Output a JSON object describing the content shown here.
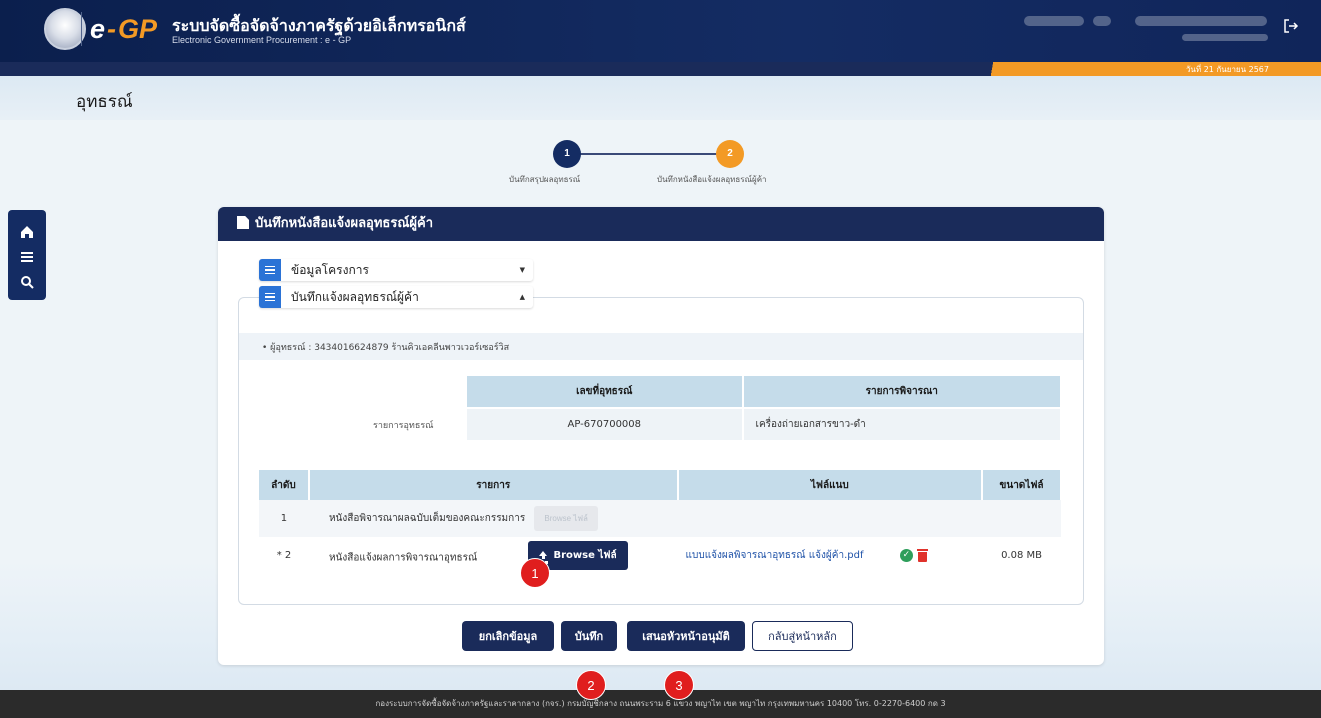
{
  "header": {
    "logo_e": "e",
    "logo_dash": "-",
    "logo_gp": "GP",
    "title": "ระบบจัดซื้อจัดจ้างภาครัฐด้วยอิเล็กทรอนิกส์",
    "subtitle": "Electronic Government Procurement : e - GP",
    "date": "วันที่ 21 กันยายน 2567",
    "logout_icon": "logout-icon"
  },
  "page": {
    "title": "อุทธรณ์"
  },
  "side_tools": {
    "icons": [
      "home-icon",
      "menu-icon",
      "search-icon"
    ]
  },
  "stepper": {
    "steps": [
      {
        "number": "1",
        "label": "บันทึกสรุปผลอุทธรณ์"
      },
      {
        "number": "2",
        "label": "บันทึกหนังสือแจ้งผลอุทธรณ์ผู้ค้า"
      }
    ]
  },
  "card": {
    "title": "บันทึกหนังสือแจ้งผลอุทธรณ์ผู้ค้า",
    "accordion": [
      {
        "label": "ข้อมูลโครงการ",
        "caret": "▼"
      },
      {
        "label": "บันทึกแจ้งผลอุทธรณ์ผู้ค้า",
        "caret": "▲"
      }
    ],
    "vendor": "• ผู้อุทธรณ์ : 3434016624879 ร้านคิวเอคลีนพาวเวอร์เซอร์วิส",
    "appeal_label": "รายการอุทธรณ์",
    "appeal_table": {
      "headers": [
        "เลขที่อุทธรณ์",
        "รายการพิจารณา"
      ],
      "row": [
        "AP-670700008",
        "เครื่องถ่ายเอกสารขาว-ดำ"
      ]
    },
    "file_table": {
      "headers": [
        "ลำดับ",
        "รายการ",
        "ไฟล์แนบ",
        "ขนาดไฟล์"
      ],
      "rows": [
        {
          "no": "1",
          "item": "หนังสือพิจารณาผลฉบับเต็มของคณะกรรมการ",
          "button": "Browse ไฟล์",
          "file": "",
          "size": ""
        },
        {
          "no": "* 2",
          "item": "หนังสือแจ้งผลการพิจารณาอุทธรณ์",
          "button": "Browse ไฟล์",
          "file": "แบบแจ้งผลพิจารณาอุทธรณ์ แจ้งผู้ค้า.pdf",
          "size": "0.08 MB"
        }
      ]
    }
  },
  "actions": {
    "cancel": "ยกเลิกข้อมูล",
    "save": "บันทึก",
    "submit": "เสนอหัวหน้าอนุมัติ",
    "back": "กลับสู่หน้าหลัก"
  },
  "badges": [
    "1",
    "2",
    "3"
  ],
  "footer": "กองระบบการจัดซื้อจัดจ้างภาครัฐและราคากลาง (กจร.) กรมบัญชีกลาง ถนนพระราม 6 แขวง พญาไท เขต พญาไท กรุงเทพมหานคร 10400 โทร. 0-2270-6400 กด 3",
  "colors": {
    "navy": "#1a2b5a",
    "orange": "#f39a25",
    "accent_blue": "#2b73d6",
    "badge_red": "#e01e1e"
  }
}
